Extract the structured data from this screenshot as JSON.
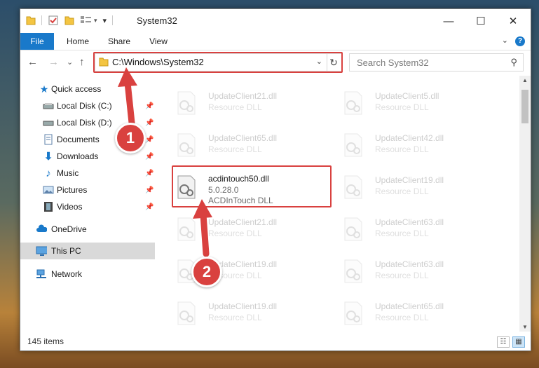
{
  "window": {
    "title": "System32",
    "controls": {
      "minimize": "—",
      "maximize": "☐",
      "close": "✕"
    }
  },
  "ribbon": {
    "tabs": [
      "File",
      "Home",
      "Share",
      "View"
    ],
    "help": "?"
  },
  "navigation": {
    "back": "←",
    "forward": "→",
    "recent": "⌄",
    "up": "↑",
    "address": "C:\\Windows\\System32",
    "search_placeholder": "Search System32"
  },
  "sidebar": {
    "items": [
      {
        "label": "Quick access",
        "icon": "star-icon",
        "pinned": false
      },
      {
        "label": "Local Disk (C:)",
        "icon": "drive-icon",
        "pinned": true
      },
      {
        "label": "Local Disk (D:)",
        "icon": "drive-icon",
        "pinned": true
      },
      {
        "label": "Documents",
        "icon": "documents-icon",
        "pinned": true
      },
      {
        "label": "Downloads",
        "icon": "download-icon",
        "pinned": true
      },
      {
        "label": "Music",
        "icon": "music-icon",
        "pinned": true
      },
      {
        "label": "Pictures",
        "icon": "pictures-icon",
        "pinned": true
      },
      {
        "label": "Videos",
        "icon": "videos-icon",
        "pinned": true
      },
      {
        "label": "OneDrive",
        "icon": "cloud-icon",
        "pinned": false
      },
      {
        "label": "This PC",
        "icon": "computer-icon",
        "pinned": false,
        "selected": true
      },
      {
        "label": "Network",
        "icon": "network-icon",
        "pinned": false
      }
    ]
  },
  "files": [
    {
      "name": "UpdateClient21.dll",
      "desc": "Resource DLL",
      "faded": true
    },
    {
      "name": "UpdateClient5.dll",
      "desc": "Resource DLL",
      "faded": true
    },
    {
      "name": "UpdateClient65.dll",
      "desc": "Resource DLL",
      "faded": true
    },
    {
      "name": "UpdateClient42.dll",
      "desc": "Resource DLL",
      "faded": true
    },
    {
      "name": "acdintouch50.dll",
      "version": "5.0.28.0",
      "desc": "ACDInTouch DLL",
      "faded": false
    },
    {
      "name": "UpdateClient19.dll",
      "desc": "Resource DLL",
      "faded": true
    },
    {
      "name": "UpdateClient21.dll",
      "desc": "Resource DLL",
      "faded": true
    },
    {
      "name": "UpdateClient63.dll",
      "desc": "Resource DLL",
      "faded": true
    },
    {
      "name": "UpdateClient19.dll",
      "desc": "Resource DLL",
      "faded": true
    },
    {
      "name": "UpdateClient63.dll",
      "desc": "Resource DLL",
      "faded": true
    },
    {
      "name": "UpdateClient19.dll",
      "desc": "Resource DLL",
      "faded": true
    },
    {
      "name": "UpdateClient65.dll",
      "desc": "Resource DLL",
      "faded": true
    }
  ],
  "status": {
    "item_count": "145 items"
  },
  "callouts": [
    "1",
    "2"
  ],
  "colors": {
    "accent": "#1979ca",
    "highlight": "#d9413f",
    "selected": "#d9d9d9"
  }
}
